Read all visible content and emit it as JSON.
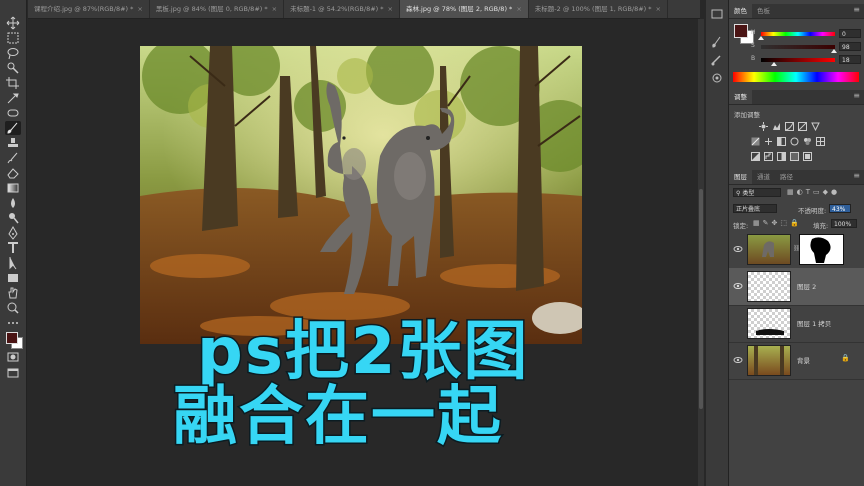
{
  "tabs": [
    {
      "label": "课程介绍.jpg @ 87%(RGB/8#) *",
      "active": false
    },
    {
      "label": "黑板.jpg @ 84% (图层 0, RGB/8#) *",
      "active": false
    },
    {
      "label": "未标题-1 @ 54.2%(RGB/8#) *",
      "active": false
    },
    {
      "label": "森林.jpg @ 78% (图层 2, RGB/8) *",
      "active": true
    },
    {
      "label": "未标题-2 @ 100% (图层 1, RGB/8#) *",
      "active": false
    }
  ],
  "overlay": {
    "line1": "ps把2张图",
    "line2": "融合在一起"
  },
  "color_panel": {
    "tabs": [
      "颜色",
      "色板"
    ],
    "fg_color": "#4a1414",
    "rows": [
      {
        "label": "H",
        "value": "0",
        "fraction": 0.0
      },
      {
        "label": "S",
        "value": "98",
        "fraction": 0.98
      },
      {
        "label": "B",
        "value": "18",
        "fraction": 0.18
      }
    ]
  },
  "adjust_panel": {
    "tab": "调整",
    "subtitle": "添加调整"
  },
  "layers_panel": {
    "tabs": [
      "图层",
      "通道",
      "路径"
    ],
    "filter_kind": "类型",
    "blend_mode": "正片叠底",
    "opacity_label": "不透明度:",
    "opacity_value": "43%",
    "lock_label": "锁定:",
    "fill_label": "填充:",
    "fill_value": "100%",
    "layers": [
      {
        "name": "",
        "type": "elephant-with-mask",
        "visible": true,
        "selected": false
      },
      {
        "name": "图层 2",
        "type": "transparent",
        "visible": true,
        "selected": true
      },
      {
        "name": "图层 1 拷贝",
        "type": "transparent-dark",
        "visible": false,
        "selected": false
      },
      {
        "name": "背景",
        "type": "forest",
        "visible": true,
        "selected": false,
        "locked": true
      }
    ]
  }
}
